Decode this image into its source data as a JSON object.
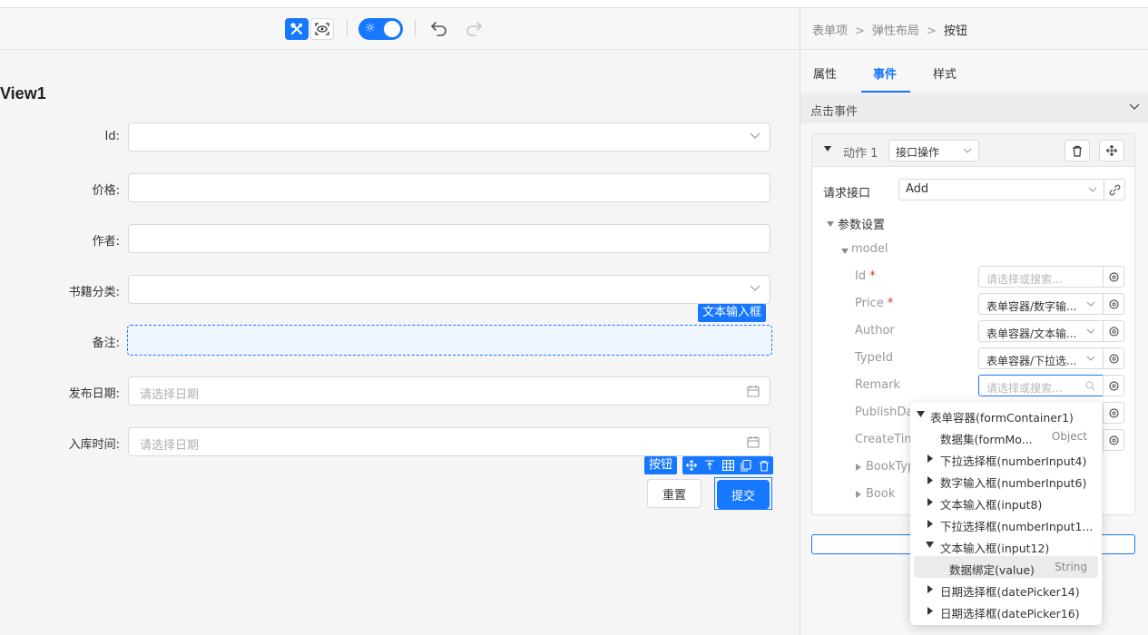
{
  "toolbar": {
    "design_icon": "tools-icon",
    "preview_icon": "preview-eye-icon",
    "theme_icon": "sun-icon",
    "undo_icon": "undo-icon",
    "redo_icon": "redo-icon"
  },
  "canvas": {
    "view_title": "View1",
    "fields": [
      {
        "label": "Id:",
        "placeholder": "",
        "kind": "select"
      },
      {
        "label": "价格:",
        "placeholder": "",
        "kind": "text"
      },
      {
        "label": "作者:",
        "placeholder": "",
        "kind": "text"
      },
      {
        "label": "书籍分类:",
        "placeholder": "",
        "kind": "select"
      },
      {
        "label": "备注:",
        "placeholder": "",
        "kind": "text"
      },
      {
        "label": "发布日期:",
        "placeholder": "请选择日期",
        "kind": "date"
      },
      {
        "label": "入库时间:",
        "placeholder": "请选择日期",
        "kind": "date"
      }
    ],
    "text_input_tag": "文本输入框",
    "button_tag": "按钮",
    "reset_label": "重置",
    "submit_label": "提交"
  },
  "panel": {
    "breadcrumb": [
      "表单项",
      "弹性布局",
      "按钮"
    ],
    "breadcrumb_sep": ">",
    "tabs": [
      "属性",
      "事件",
      "样式"
    ],
    "active_tab": "事件",
    "event_title": "点击事件",
    "action_label": "动作 1",
    "action_type": "接口操作",
    "request_label": "请求接口",
    "request_value": "Add",
    "param_group": "参数设置",
    "model_group": "model",
    "params": [
      {
        "name": "Id",
        "required": true,
        "value": "请选择或搜索...",
        "placeholder": true
      },
      {
        "name": "Price",
        "required": true,
        "value": "表单容器/数字输...",
        "placeholder": false
      },
      {
        "name": "Author",
        "required": false,
        "value": "表单容器/文本输...",
        "placeholder": false
      },
      {
        "name": "TypeId",
        "required": false,
        "value": "表单容器/下拉选...",
        "placeholder": false
      },
      {
        "name": "Remark",
        "required": false,
        "value": "请选择或搜索...",
        "placeholder": true
      },
      {
        "name": "PublishDa",
        "required": false,
        "value": "",
        "placeholder": false
      },
      {
        "name": "CreateTim",
        "required": false,
        "value": "",
        "placeholder": false
      }
    ],
    "collapsed_groups": [
      "BookTyp",
      "Book"
    ]
  },
  "dropdown": {
    "items": [
      {
        "label": "表单容器(formContainer1)",
        "type": "",
        "level": 0,
        "arrow": "down"
      },
      {
        "label": "数据集(formMo...",
        "type": "Object",
        "level": 1,
        "arrow": "none"
      },
      {
        "label": "下拉选择框(numberInput4)",
        "type": "",
        "level": 1,
        "arrow": "right"
      },
      {
        "label": "数字输入框(numberInput6)",
        "type": "",
        "level": 1,
        "arrow": "right"
      },
      {
        "label": "文本输入框(input8)",
        "type": "",
        "level": 1,
        "arrow": "right"
      },
      {
        "label": "下拉选择框(numberInput1...",
        "type": "",
        "level": 1,
        "arrow": "right"
      },
      {
        "label": "文本输入框(input12)",
        "type": "",
        "level": 1,
        "arrow": "down"
      },
      {
        "label": "数据绑定(value)",
        "type": "String",
        "level": 2,
        "arrow": "none",
        "highlight": true
      },
      {
        "label": "日期选择框(datePicker14)",
        "type": "",
        "level": 1,
        "arrow": "right"
      },
      {
        "label": "日期选择框(datePicker16)",
        "type": "",
        "level": 1,
        "arrow": "right"
      }
    ]
  },
  "colors": {
    "accent": "#1677ff",
    "required": "#e0301e"
  }
}
